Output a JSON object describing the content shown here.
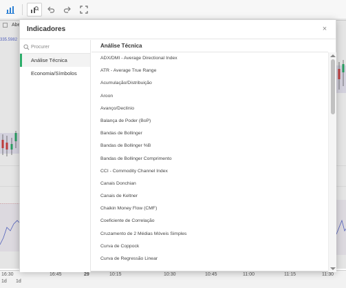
{
  "toolbar": {
    "tools": [
      {
        "icon": "bar-chart-icon"
      },
      {
        "icon": "indicators-icon"
      },
      {
        "icon": "undo-icon"
      },
      {
        "icon": "redo-icon"
      },
      {
        "icon": "fullscreen-icon"
      }
    ]
  },
  "chart": {
    "partial_label": "Abe",
    "price_label": "335.5982",
    "time_labels": [
      "16:30",
      "16:45",
      "29",
      "10:15",
      "10:30",
      "10:45",
      "11:00",
      "11:15",
      "11:30"
    ],
    "period_labels": [
      "1d",
      "1d"
    ],
    "accent_color": "#2dae6b"
  },
  "modal": {
    "title": "Indicadores",
    "close_glyph": "×",
    "search_placeholder": "Procurer",
    "categories": [
      {
        "label": "Análise Técnica",
        "active": true
      },
      {
        "label": "Economia/Símbolos",
        "active": false
      }
    ],
    "section_title": "Análise Técnica",
    "indicators": [
      "ADX/DMI - Average Directional Index",
      "ATR - Average True Range",
      "Acumulação/Distribuição",
      "Aroon",
      "Avanço/Declínio",
      "Balança de Poder (BoP)",
      "Bandas de Bollinger",
      "Bandas de Bollinger %B",
      "Bandas de Bollinger Comprimento",
      "CCI - Commodity Channel Index",
      "Canais Donchian",
      "Canais de Keltner",
      "Chaikin Money Flow (CMF)",
      "Coeficiente de Correlação",
      "Cruzamento de 2 Médias Móveis Simples",
      "Curva de Coppock",
      "Curva de Regressão Linear"
    ]
  }
}
